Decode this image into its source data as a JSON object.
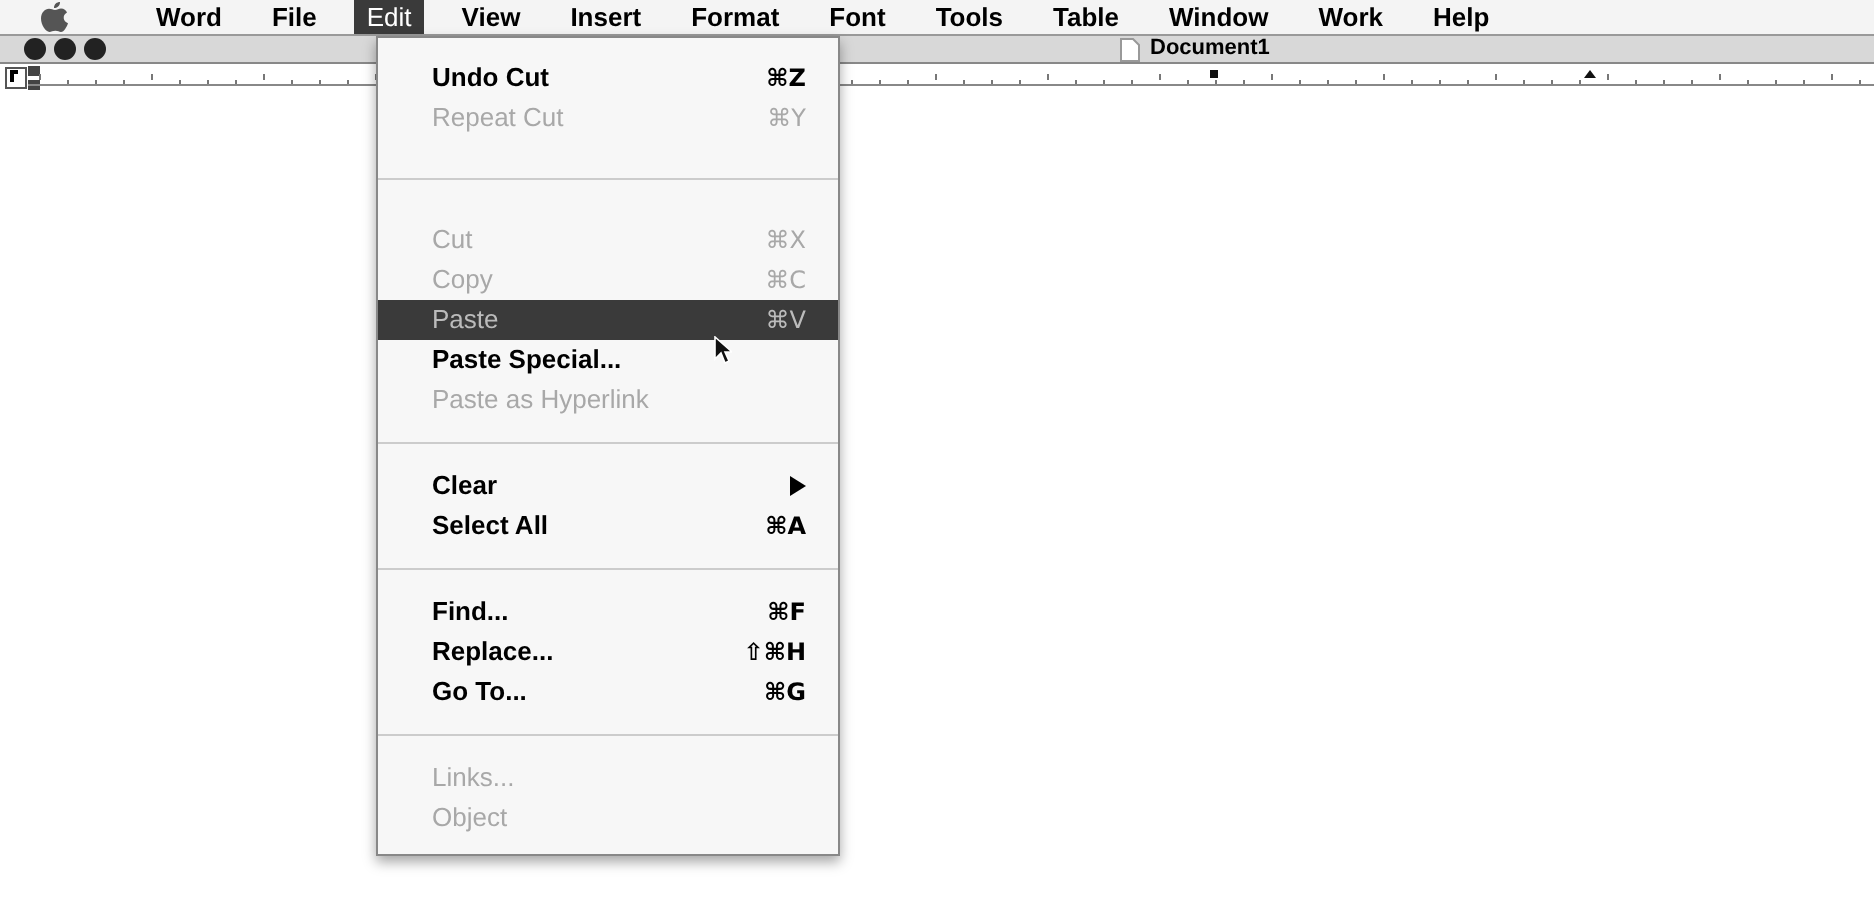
{
  "menu_bar": {
    "items": [
      {
        "label": "Word",
        "selected": false
      },
      {
        "label": "File",
        "selected": false
      },
      {
        "label": "Edit",
        "selected": true
      },
      {
        "label": "View",
        "selected": false
      },
      {
        "label": "Insert",
        "selected": false
      },
      {
        "label": "Format",
        "selected": false
      },
      {
        "label": "Font",
        "selected": false
      },
      {
        "label": "Tools",
        "selected": false
      },
      {
        "label": "Table",
        "selected": false
      },
      {
        "label": "Window",
        "selected": false
      },
      {
        "label": "Work",
        "selected": false
      },
      {
        "label": "Help",
        "selected": false
      }
    ]
  },
  "window": {
    "title": "Document1"
  },
  "edit_menu": {
    "items": [
      {
        "kind": "item",
        "label": "Undo Cut",
        "shortcut": "⌘Z",
        "disabled": false,
        "selected": false
      },
      {
        "kind": "item",
        "label": "Repeat Cut",
        "shortcut": "⌘Y",
        "disabled": true,
        "selected": false
      },
      {
        "kind": "separator"
      },
      {
        "kind": "item",
        "label": "Cut",
        "shortcut": "⌘X",
        "disabled": true,
        "selected": false
      },
      {
        "kind": "item",
        "label": "Copy",
        "shortcut": "⌘C",
        "disabled": true,
        "selected": false
      },
      {
        "kind": "item",
        "label": "Paste",
        "shortcut": "⌘V",
        "disabled": true,
        "selected": true
      },
      {
        "kind": "item",
        "label": "Paste Special...",
        "disabled": false,
        "selected": false
      },
      {
        "kind": "item",
        "label": "Paste as Hyperlink",
        "disabled": true,
        "selected": false
      },
      {
        "kind": "separator"
      },
      {
        "kind": "submenu",
        "label": "Clear",
        "disabled": false,
        "selected": false
      },
      {
        "kind": "item",
        "label": "Select All",
        "shortcut": "⌘A",
        "disabled": false,
        "selected": false
      },
      {
        "kind": "separator"
      },
      {
        "kind": "item",
        "label": "Find...",
        "shortcut": "⌘F",
        "disabled": false,
        "selected": false
      },
      {
        "kind": "item",
        "label": "Replace...",
        "shortcut": "⇧⌘H",
        "disabled": false,
        "selected": false
      },
      {
        "kind": "item",
        "label": "Go To...",
        "shortcut": "⌘G",
        "disabled": false,
        "selected": false
      },
      {
        "kind": "separator"
      },
      {
        "kind": "item",
        "label": "Links...",
        "disabled": true,
        "selected": false
      },
      {
        "kind": "item",
        "label": "Object",
        "disabled": true,
        "selected": false
      }
    ]
  }
}
